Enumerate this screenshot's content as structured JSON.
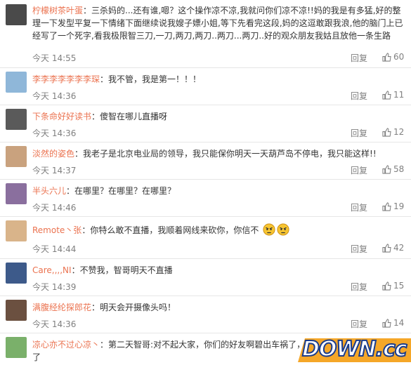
{
  "comments": [
    {
      "user": "柠檬树茶叶蛋",
      "text": "三杀妈的...还有谁,嗯？这个操作凉不凉,我就问你们凉不凉!!妈的我是有多猛,好的整理一下发型平复一下情绪下面继续说我嫂子嫖小姐,等下先看完这段,妈的这逗敢跟我浪,他的脑门上已经写了一个死字,看我极限智三刀,一刀,两刀,两刀..两刀...两刀..好的观众朋友我姑且放他一条生路",
      "time": "今天 14:55",
      "reply": "回复",
      "likes": "60",
      "avatar_color": "#4a4a4a"
    },
    {
      "user": "李李李李李李李琛",
      "text": "我不管，我是第一！！！",
      "time": "今天 14:36",
      "reply": "回复",
      "likes": "11",
      "avatar_color": "#8fb7d9"
    },
    {
      "user": "下条命好好读书",
      "text": "傻智在哪儿直播呀",
      "time": "今天 14:36",
      "reply": "回复",
      "likes": "12",
      "avatar_color": "#5a5a5a"
    },
    {
      "user": "淡然的姿色",
      "text": "我老子是北京电业局的领导，我只能保你明天一天葫芦岛不停电，我只能这样!!",
      "time": "今天 14:37",
      "reply": "回复",
      "likes": "58",
      "avatar_color": "#c9a27e"
    },
    {
      "user": "半头六儿",
      "text": "在哪里？在哪里？在哪里？",
      "time": "今天 14:46",
      "reply": "回复",
      "likes": "19",
      "avatar_color": "#8a6f9e"
    },
    {
      "user": "Remote丶张",
      "text": "你特么敢不直播，我顺着网线来砍你，你信不",
      "time": "今天 14:44",
      "reply": "回复",
      "likes": "42",
      "avatar_color": "#d9b48a"
    },
    {
      "user": "Care,,,,NI",
      "text": "不赞我，智哥明天不直播",
      "time": "今天 14:39",
      "reply": "回复",
      "likes": "15",
      "avatar_color": "#3d5a8a"
    },
    {
      "user": "满腹经纶探郎花",
      "text": "明天会开摄像头吗！",
      "time": "今天 14:36",
      "reply": "回复",
      "likes": "14",
      "avatar_color": "#6b5040"
    },
    {
      "user": "凉心亦不过心凉丶",
      "text": "第二天智哥:对不起大家，你们的好友啊碧出车祸了，",
      "text2": "了",
      "avatar_color": "#7ab06a"
    }
  ],
  "watermark": {
    "main": "DOWN",
    "suffix": ".cc"
  },
  "colors": {
    "nick": "#eb7350",
    "meta": "#808080"
  },
  "icons": {
    "like": "thumb-up-icon",
    "emoji": "angry-face-icon"
  }
}
